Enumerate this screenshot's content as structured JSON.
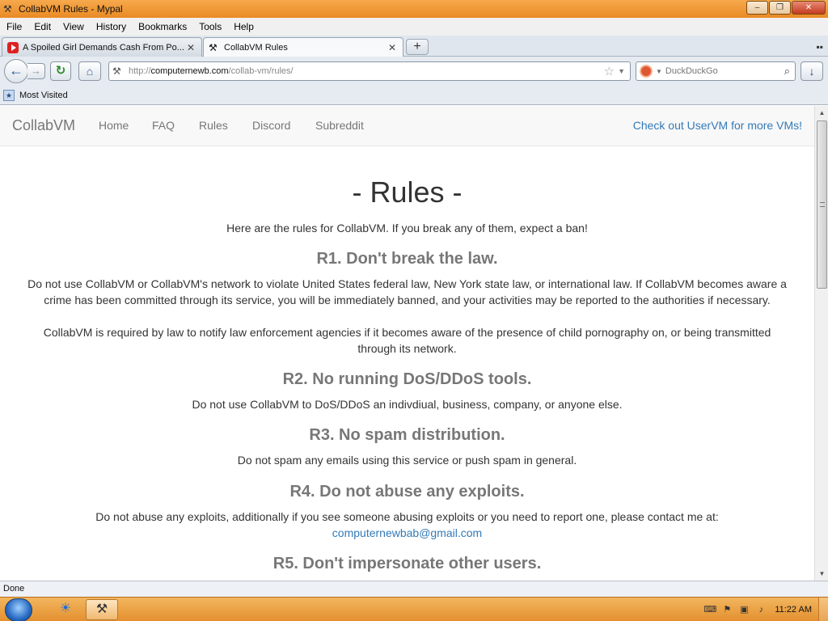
{
  "window": {
    "title": "CollabVM Rules - Mypal",
    "minimize": "‒",
    "maximize": "❐",
    "close": "✕"
  },
  "menu": [
    "File",
    "Edit",
    "View",
    "History",
    "Bookmarks",
    "Tools",
    "Help"
  ],
  "tabs": [
    {
      "label": "A Spoiled Girl Demands Cash From Po...",
      "close": "✕"
    },
    {
      "label": "CollabVM Rules",
      "close": "✕"
    }
  ],
  "tabstrip": {
    "new_tab": "+",
    "list": "▪▪"
  },
  "nav": {
    "back": "←",
    "forward": "→",
    "reload": "↻",
    "home": "⌂",
    "url_scheme": "http://",
    "url_domain": "computernewb.com",
    "url_path": "/collab-vm/rules/",
    "bookmark_star": "☆",
    "url_drop": "▼",
    "search_placeholder": "DuckDuckGo",
    "search_drop": "▼",
    "search_icon": "⌕",
    "download": "↓"
  },
  "bookmarks": {
    "most_visited": "Most Visited"
  },
  "site": {
    "brand": "CollabVM",
    "links": [
      "Home",
      "FAQ",
      "Rules",
      "Discord",
      "Subreddit"
    ],
    "uservm": "Check out UserVM for more VMs!"
  },
  "page": {
    "title": "- Rules -",
    "intro": "Here are the rules for CollabVM. If you break any of them, expect a ban!",
    "r1_heading": "R1. Don't break the law.",
    "r1_p1": "Do not use CollabVM or CollabVM's network to violate United States federal law, New York state law, or international law. If CollabVM becomes aware a crime has been committed through its service, you will be immediately banned, and your activities may be reported to the authorities if necessary.",
    "r1_p2": "CollabVM is required by law to notify law enforcement agencies if it becomes aware of the presence of child pornography on, or being transmitted through its network.",
    "r2_heading": "R2. No running DoS/DDoS tools.",
    "r2_p": "Do not use CollabVM to DoS/DDoS an indivdiual, business, company, or anyone else.",
    "r3_heading": "R3. No spam distribution.",
    "r3_p": "Do not spam any emails using this service or push spam in general.",
    "r4_heading": "R4. Do not abuse any exploits.",
    "r4_p": "Do not abuse any exploits, additionally if you see someone abusing exploits or you need to report one, please contact me at:",
    "r4_email": "computernewbab@gmail.com",
    "r5_heading": "R5. Don't impersonate other users."
  },
  "scroll": {
    "up": "▲",
    "down": "▼",
    "position": 0.0
  },
  "status": {
    "text": "Done"
  },
  "taskbar": {
    "clock": "11:22 AM"
  },
  "colors": {
    "accent_link": "#337ab7",
    "heading_gray": "#777777",
    "titlebar_orange": "#e98a24"
  }
}
